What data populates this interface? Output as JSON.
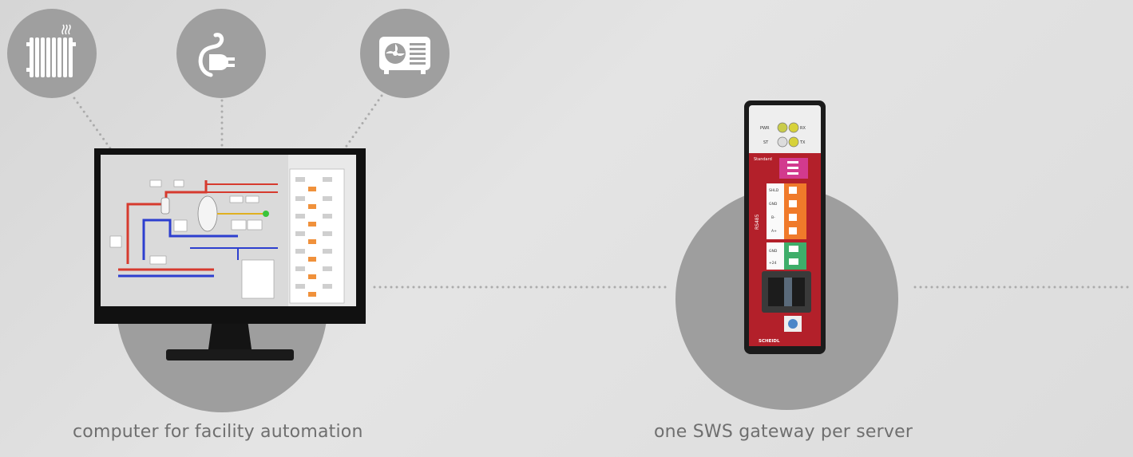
{
  "captions": {
    "computer": "computer for facility automation",
    "gateway": "one SWS gateway per server"
  },
  "icons": [
    "radiator-icon",
    "power-plug-icon",
    "ac-unit-icon"
  ],
  "gateway_device": {
    "leds": [
      "PWR",
      "RX",
      "ST",
      "TX"
    ],
    "dip_title": "Standard",
    "port_group_label": "RS485",
    "terminal_labels": [
      "SHLD",
      "GND",
      "B-",
      "A+"
    ],
    "power_labels": [
      "GND",
      "+24"
    ],
    "brand": "SCHEIDL"
  },
  "colors": {
    "background": "#dedede",
    "circle": "#9f9f9f",
    "dotted_line": "#ababab",
    "gateway_red": "#b3202a",
    "terminal_orange": "#f07a2a",
    "terminal_green": "#3fae6a",
    "caption_text": "#6f6f6f"
  }
}
